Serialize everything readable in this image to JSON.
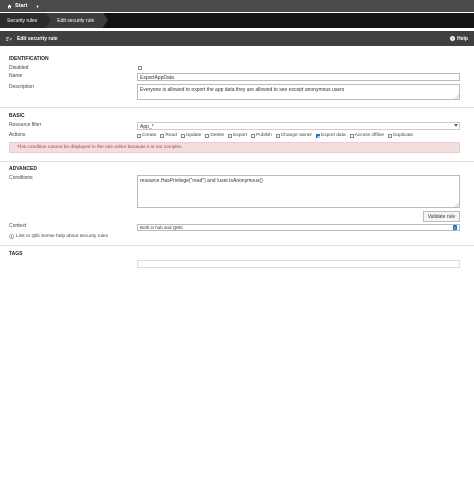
{
  "topbar": {
    "hub_label": "Start",
    "caret": "▼"
  },
  "breadcrumb": {
    "items": [
      "Security rules",
      "Edit security rule"
    ]
  },
  "titlebar": {
    "title": "Edit security rule",
    "help_label": "Help"
  },
  "identification": {
    "heading": "IDENTIFICATION",
    "disabled_label": "Disabled",
    "name_label": "Name",
    "name_value": "ExportAppData",
    "description_label": "Description",
    "description_value": "Everyone is allowed to export the app data they are allowed to see except anonymous users"
  },
  "basic": {
    "heading": "BASIC",
    "resource_filter_label": "Resource filter",
    "resource_filter_value": "App_*",
    "actions_label": "Actions",
    "actions": [
      {
        "label": "Create",
        "checked": false
      },
      {
        "label": "Read",
        "checked": false
      },
      {
        "label": "Update",
        "checked": false
      },
      {
        "label": "Delete",
        "checked": false
      },
      {
        "label": "Export",
        "checked": false
      },
      {
        "label": "Publish",
        "checked": false
      },
      {
        "label": "Change owner",
        "checked": false
      },
      {
        "label": "Export data",
        "checked": true
      },
      {
        "label": "Access offline",
        "checked": false
      },
      {
        "label": "Duplicate",
        "checked": false
      }
    ],
    "warning": "This condition cannot be displayed in the rule editor because it is too complex."
  },
  "advanced": {
    "heading": "ADVANCED",
    "conditions_label": "Conditions",
    "conditions_value": "resource.HasPrivilege(\"read\") and !user.IsAnonymous()",
    "validate_label": "Validate rule",
    "context_label": "Context",
    "context_value": "Both in hub and QMC",
    "help_link": "Link to Qlik Sense help about security rules"
  },
  "tags": {
    "heading": "TAGS"
  },
  "colors": {
    "accent": "#1a6fd1",
    "topbar": "#4a4a4a",
    "warning_bg": "#f2dede",
    "warning_text": "#a94442"
  }
}
